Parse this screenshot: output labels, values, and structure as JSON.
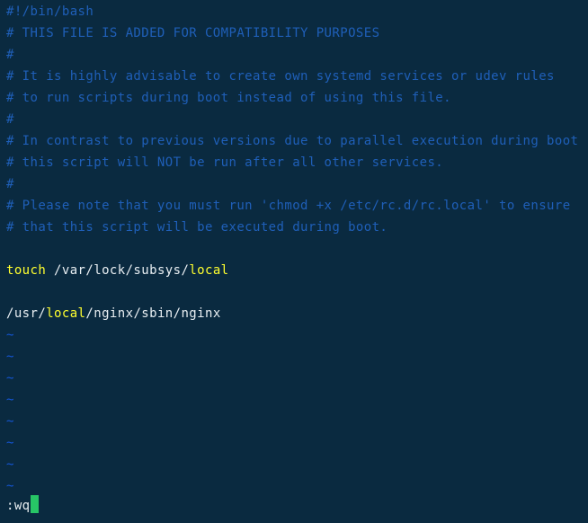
{
  "terminal": {
    "app": "vim",
    "background_color": "#0a2a40",
    "comment_color": "#1f5fb8",
    "tilde_color": "#1456d6",
    "text_color": "#e8eef2",
    "keyword_color": "#ffff2e",
    "cursor_color": "#27c566",
    "columns": 71,
    "rows": 24
  },
  "buffer": {
    "lines": [
      {
        "segments": [
          {
            "text": "#!/bin/bash",
            "style": "comment"
          }
        ]
      },
      {
        "segments": [
          {
            "text": "# THIS FILE IS ADDED FOR COMPATIBILITY PURPOSES",
            "style": "comment"
          }
        ]
      },
      {
        "segments": [
          {
            "text": "#",
            "style": "comment"
          }
        ]
      },
      {
        "segments": [
          {
            "text": "# It is highly advisable to create own systemd services or udev rules",
            "style": "comment"
          }
        ]
      },
      {
        "segments": [
          {
            "text": "# to run scripts during boot instead of using this file.",
            "style": "comment"
          }
        ]
      },
      {
        "segments": [
          {
            "text": "#",
            "style": "comment"
          }
        ]
      },
      {
        "segments": [
          {
            "text": "# In contrast to previous versions due to parallel execution during boot",
            "style": "comment"
          }
        ]
      },
      {
        "segments": [
          {
            "text": "# this script will NOT be run after all other services.",
            "style": "comment"
          }
        ]
      },
      {
        "segments": [
          {
            "text": "#",
            "style": "comment"
          }
        ]
      },
      {
        "segments": [
          {
            "text": "# Please note that you must run 'chmod +x /etc/rc.d/rc.local' to ensure",
            "style": "comment"
          }
        ]
      },
      {
        "segments": [
          {
            "text": "# that this script will be executed during boot.",
            "style": "comment"
          }
        ]
      },
      {
        "segments": [
          {
            "text": "",
            "style": "blank"
          }
        ]
      },
      {
        "segments": [
          {
            "text": "touch",
            "style": "keyword"
          },
          {
            "text": " /var/lock/subsys/",
            "style": "plain"
          },
          {
            "text": "local",
            "style": "dirword"
          }
        ]
      },
      {
        "segments": [
          {
            "text": "",
            "style": "blank"
          }
        ]
      },
      {
        "segments": [
          {
            "text": "/usr/",
            "style": "plain"
          },
          {
            "text": "local",
            "style": "dirword"
          },
          {
            "text": "/nginx/sbin/nginx",
            "style": "plain"
          }
        ]
      },
      {
        "segments": [
          {
            "text": "~",
            "style": "tilde"
          }
        ]
      },
      {
        "segments": [
          {
            "text": "~",
            "style": "tilde"
          }
        ]
      },
      {
        "segments": [
          {
            "text": "~",
            "style": "tilde"
          }
        ]
      },
      {
        "segments": [
          {
            "text": "~",
            "style": "tilde"
          }
        ]
      },
      {
        "segments": [
          {
            "text": "~",
            "style": "tilde"
          }
        ]
      },
      {
        "segments": [
          {
            "text": "~",
            "style": "tilde"
          }
        ]
      },
      {
        "segments": [
          {
            "text": "~",
            "style": "tilde"
          }
        ]
      },
      {
        "segments": [
          {
            "text": "~",
            "style": "tilde"
          }
        ]
      }
    ]
  },
  "status_line": {
    "command": ":wq",
    "cursor_visible": true
  }
}
